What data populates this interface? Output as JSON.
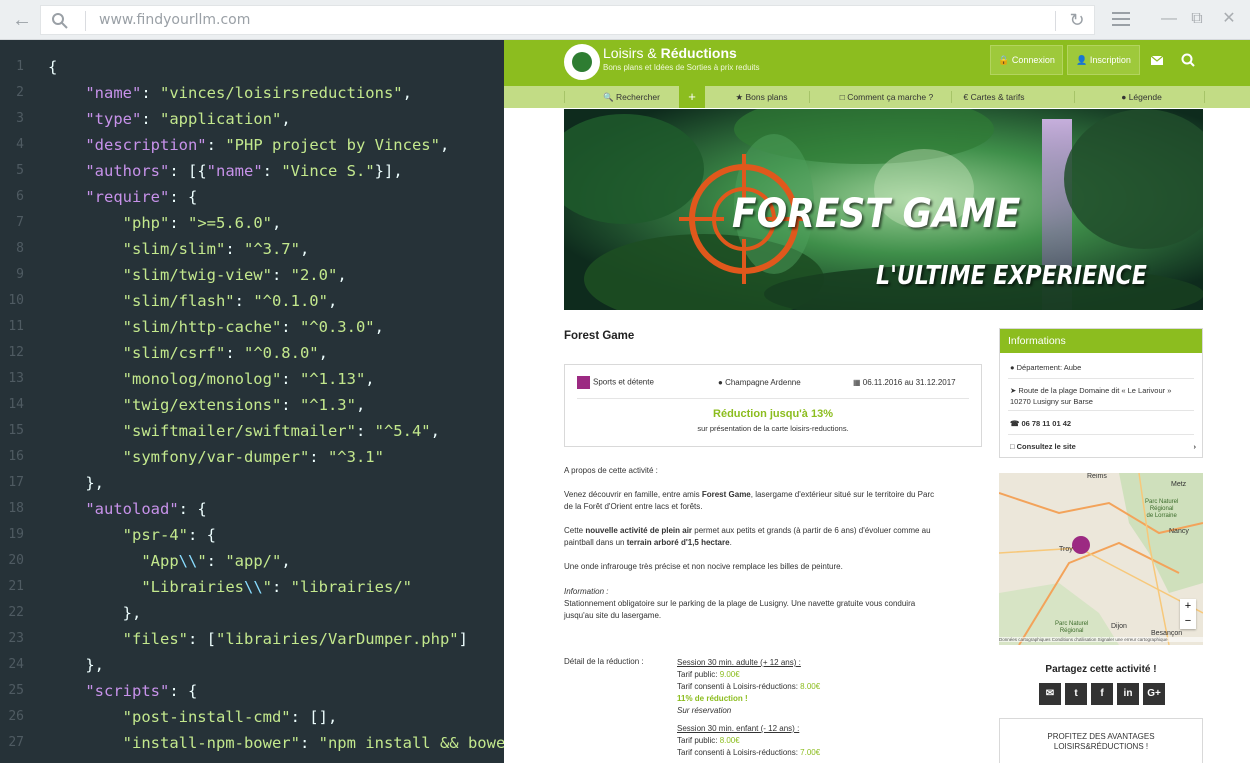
{
  "browser": {
    "url": "www.findyourllm.com"
  },
  "code": {
    "lines": [
      {
        "n": "1",
        "html": "<span class='n'>{</span>"
      },
      {
        "n": "2",
        "html": "    <span class='k'>\"name\"</span><span class='n'>: </span><span class='s'>\"vinces/loisirsreductions\"</span><span class='n'>,</span>"
      },
      {
        "n": "3",
        "html": "    <span class='k'>\"type\"</span><span class='n'>: </span><span class='s'>\"application\"</span><span class='n'>,</span>"
      },
      {
        "n": "4",
        "html": "    <span class='k'>\"description\"</span><span class='n'>: </span><span class='s'>\"PHP project by Vinces\"</span><span class='n'>,</span>"
      },
      {
        "n": "5",
        "html": "    <span class='k'>\"authors\"</span><span class='n'>: [{</span><span class='k'>\"name\"</span><span class='n'>: </span><span class='s'>\"Vince S.\"</span><span class='n'>}],</span>"
      },
      {
        "n": "6",
        "html": "    <span class='k'>\"require\"</span><span class='n'>: {</span>"
      },
      {
        "n": "7",
        "html": "        <span class='s'>\"php\"</span><span class='n'>: </span><span class='s'>\">=5.6.0\"</span><span class='n'>,</span>"
      },
      {
        "n": "8",
        "html": "        <span class='s'>\"slim/slim\"</span><span class='n'>: </span><span class='s'>\"^3.7\"</span><span class='n'>,</span>"
      },
      {
        "n": "9",
        "html": "        <span class='s'>\"slim/twig-view\"</span><span class='n'>: </span><span class='s'>\"2.0\"</span><span class='n'>,</span>"
      },
      {
        "n": "10",
        "html": "        <span class='s'>\"slim/flash\"</span><span class='n'>: </span><span class='s'>\"^0.1.0\"</span><span class='n'>,</span>"
      },
      {
        "n": "11",
        "html": "        <span class='s'>\"slim/http-cache\"</span><span class='n'>: </span><span class='s'>\"^0.3.0\"</span><span class='n'>,</span>"
      },
      {
        "n": "12",
        "html": "        <span class='s'>\"slim/csrf\"</span><span class='n'>: </span><span class='s'>\"^0.8.0\"</span><span class='n'>,</span>"
      },
      {
        "n": "13",
        "html": "        <span class='s'>\"monolog/monolog\"</span><span class='n'>: </span><span class='s'>\"^1.13\"</span><span class='n'>,</span>"
      },
      {
        "n": "14",
        "html": "        <span class='s'>\"twig/extensions\"</span><span class='n'>: </span><span class='s'>\"^1.3\"</span><span class='n'>,</span>"
      },
      {
        "n": "15",
        "html": "        <span class='s'>\"swiftmailer/swiftmailer\"</span><span class='n'>: </span><span class='s'>\"^5.4\"</span><span class='n'>,</span>"
      },
      {
        "n": "16",
        "html": "        <span class='s'>\"symfony/var-dumper\"</span><span class='n'>: </span><span class='s'>\"^3.1\"</span>"
      },
      {
        "n": "17",
        "html": "    <span class='n'>},</span>"
      },
      {
        "n": "18",
        "html": "    <span class='k'>\"autoload\"</span><span class='n'>: {</span>"
      },
      {
        "n": "19",
        "html": "        <span class='s'>\"psr-4\"</span><span class='n'>: {</span>"
      },
      {
        "n": "20",
        "html": "          <span class='s'>\"App</span><span class='p'>\\\\</span><span class='s'>\"</span><span class='n'>: </span><span class='s'>\"app/\"</span><span class='n'>,</span>"
      },
      {
        "n": "21",
        "html": "          <span class='s'>\"Librairies</span><span class='p'>\\\\</span><span class='s'>\"</span><span class='n'>: </span><span class='s'>\"librairies/\"</span>"
      },
      {
        "n": "22",
        "html": "        <span class='n'>},</span>"
      },
      {
        "n": "23",
        "html": "        <span class='s'>\"files\"</span><span class='n'>: [</span><span class='s'>\"librairies/VarDumper.php\"</span><span class='n'>]</span>"
      },
      {
        "n": "24",
        "html": "    <span class='n'>},</span>"
      },
      {
        "n": "25",
        "html": "    <span class='k'>\"scripts\"</span><span class='n'>: {</span>"
      },
      {
        "n": "26",
        "html": "        <span class='s'>\"post-install-cmd\"</span><span class='n'>: [],</span>"
      },
      {
        "n": "27",
        "html": "        <span class='s'>\"install-npm-bower\"</span><span class='n'>: </span><span class='s'>\"npm install &amp;&amp; bower</span>"
      }
    ]
  },
  "site": {
    "brand_a": "Loisirs & ",
    "brand_b": "Réductions",
    "tagline": "Bons plans et Idées de Sorties à prix reduits",
    "login": "Connexion",
    "signup": "Inscription",
    "nav": [
      "Rechercher",
      "Bons plans",
      "Comment ça marche ?",
      "Cartes & tarifs",
      "Légende"
    ],
    "nav_plus": "+",
    "hero_title": "FOREST GAME",
    "hero_sub": "L'ULTIME EXPERIENCE",
    "title": "Forest Game",
    "category": "Sports et détente",
    "region": "Champagne Ardenne",
    "dates": "06.11.2016 au 31.12.2017",
    "reduction": "Réduction jusqu'à 13%",
    "reduction_sub": "sur présentation de la carte loisirs-reductions.",
    "about": "A propos de cette activité :",
    "p1a": "Venez découvrir en famille, entre amis ",
    "p1b": "Forest Game",
    "p1c": ", lasergame d'extérieur situé sur le territoire du Parc",
    "p1d": "de la Forêt d'Orient entre lacs et forêts.",
    "p2a": "Cette ",
    "p2b": "nouvelle activité de plein air",
    "p2c": " permet aux petits et grands (à partir de 6 ans) d'évoluer comme au",
    "p2d": "paintball dans un ",
    "p2e": "terrain arboré d'1,5 hectare",
    "p2f": ".",
    "p3": "Une onde infrarouge très précise et non nocive remplace les billes de peinture.",
    "info_label": "Information :",
    "info_text1": "Stationnement obligatoire sur le parking de la plage de Lusigny. Une navette gratuite vous conduira",
    "info_text2": "jusqu'au site du lasergame.",
    "detail_label": "Détail de la réduction :",
    "d1": "Session 30 min. adulte (+ 12 ans) :",
    "d2a": "Tarif public: ",
    "d2b": "9.00€",
    "d3a": "Tarif consenti à Loisirs-réductions: ",
    "d3b": "8.00€",
    "d4": "11% de réduction !",
    "d5": "Sur réservation",
    "d6": "Session 30 min. enfant (- 12 ans) :",
    "d7a": "Tarif public: ",
    "d7b": "8.00€",
    "d8a": "Tarif consenti à Loisirs-réductions: ",
    "d8b": "7.00€",
    "side_head": "Informations",
    "dept": "Département: Aube",
    "addr1": "Route de la plage Domaine dit « Le Larivour »",
    "addr2": "10270 Lusigny sur Barse",
    "phone": "06 78 11 01 42",
    "site_link": "Consultez le site",
    "share": "Partagez cette activité !",
    "share_btns": [
      "✉",
      "t",
      "f",
      "in",
      "G+"
    ],
    "promo1": "PROFITEZ DES AVANTAGES",
    "promo2": "LOISIRS&RÉDUCTIONS !",
    "map_labels": {
      "reims": "Reims",
      "metz": "Metz",
      "nancy": "Nancy",
      "troyes": "Troy",
      "dijon": "Dijon",
      "besancon": "Besançon",
      "parc1": "Parc Naturel",
      "parc2": "Régional",
      "parc3": "de Lorraine",
      "parc4": "Parc Naturel",
      "parc5": "Régional",
      "footer": "Données cartographiques   Conditions d'utilisation   Signaler une erreur cartographique"
    }
  }
}
